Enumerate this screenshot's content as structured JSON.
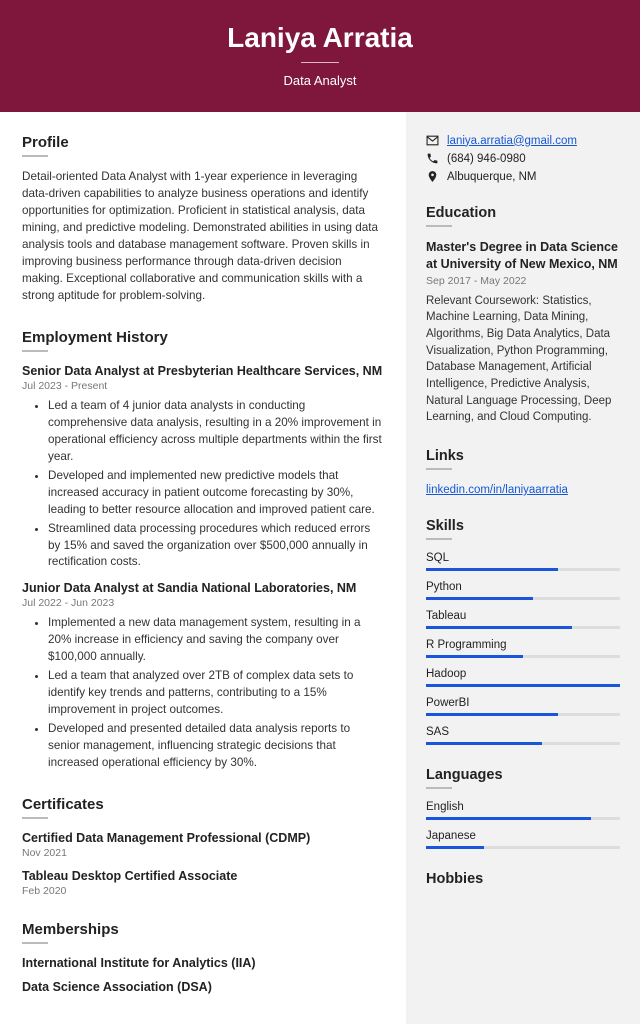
{
  "header": {
    "name": "Laniya Arratia",
    "role": "Data Analyst"
  },
  "profile": {
    "title": "Profile",
    "text": "Detail-oriented Data Analyst with 1-year experience in leveraging data-driven capabilities to analyze business operations and identify opportunities for optimization. Proficient in statistical analysis, data mining, and predictive modeling. Demonstrated abilities in using data analysis tools and database management software. Proven skills in improving business performance through data-driven decision making. Exceptional collaborative and communication skills with a strong aptitude for problem-solving."
  },
  "employment": {
    "title": "Employment History",
    "jobs": [
      {
        "title": "Senior Data Analyst at Presbyterian Healthcare Services, NM",
        "date": "Jul 2023 - Present",
        "bullets": [
          "Led a team of 4 junior data analysts in conducting comprehensive data analysis, resulting in a 20% improvement in operational efficiency across multiple departments within the first year.",
          "Developed and implemented new predictive models that increased accuracy in patient outcome forecasting by 30%, leading to better resource allocation and improved patient care.",
          "Streamlined data processing procedures which reduced errors by 15% and saved the organization over $500,000 annually in rectification costs."
        ]
      },
      {
        "title": "Junior Data Analyst at Sandia National Laboratories, NM",
        "date": "Jul 2022 - Jun 2023",
        "bullets": [
          "Implemented a new data management system, resulting in a 20% increase in efficiency and saving the company over $100,000 annually.",
          "Led a team that analyzed over 2TB of complex data sets to identify key trends and patterns, contributing to a 15% improvement in project outcomes.",
          "Developed and presented detailed data analysis reports to senior management, influencing strategic decisions that increased operational efficiency by 30%."
        ]
      }
    ]
  },
  "certificates": {
    "title": "Certificates",
    "items": [
      {
        "name": "Certified Data Management Professional (CDMP)",
        "date": "Nov 2021"
      },
      {
        "name": "Tableau Desktop Certified Associate",
        "date": "Feb 2020"
      }
    ]
  },
  "memberships": {
    "title": "Memberships",
    "items": [
      {
        "name": "International Institute for Analytics (IIA)"
      },
      {
        "name": "Data Science Association (DSA)"
      }
    ]
  },
  "contact": {
    "email": "laniya.arratia@gmail.com",
    "phone": "(684) 946-0980",
    "location": "Albuquerque, NM"
  },
  "education": {
    "title": "Education",
    "degree": "Master's Degree in Data Science at University of New Mexico, NM",
    "date": "Sep 2017 - May 2022",
    "text": "Relevant Coursework: Statistics, Machine Learning, Data Mining, Algorithms, Big Data Analytics, Data Visualization, Python Programming, Database Management, Artificial Intelligence, Predictive Analysis, Natural Language Processing, Deep Learning, and Cloud Computing."
  },
  "links": {
    "title": "Links",
    "url": "linkedin.com/in/laniyaarratia"
  },
  "skills": {
    "title": "Skills",
    "items": [
      {
        "name": "SQL",
        "level": 68
      },
      {
        "name": "Python",
        "level": 55
      },
      {
        "name": "Tableau",
        "level": 75
      },
      {
        "name": "R Programming",
        "level": 50
      },
      {
        "name": "Hadoop",
        "level": 100
      },
      {
        "name": "PowerBI",
        "level": 68
      },
      {
        "name": "SAS",
        "level": 60
      }
    ]
  },
  "languages": {
    "title": "Languages",
    "items": [
      {
        "name": "English",
        "level": 85
      },
      {
        "name": "Japanese",
        "level": 30
      }
    ]
  },
  "hobbies": {
    "title": "Hobbies"
  }
}
